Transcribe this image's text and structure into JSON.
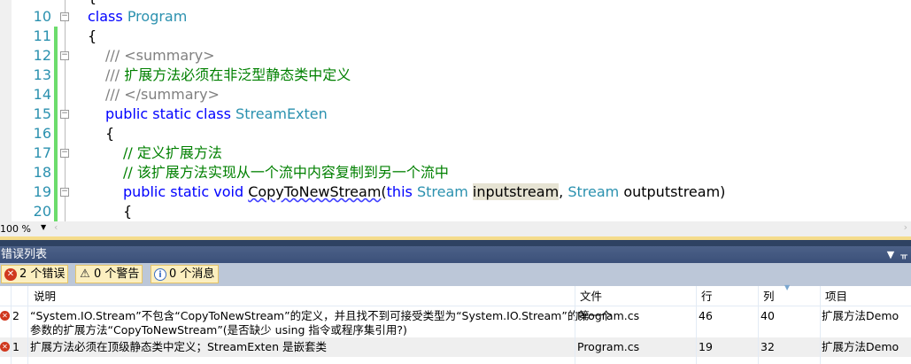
{
  "editor": {
    "lines": [
      {
        "n": "10",
        "fold": true,
        "indent": 0,
        "tokens": [
          [
            "kw",
            "class "
          ],
          [
            "ty",
            "Program"
          ]
        ]
      },
      {
        "n": "11",
        "fold": false,
        "indent": 0,
        "tokens": [
          [
            "",
            "{"
          ]
        ]
      },
      {
        "n": "12",
        "fold": true,
        "indent": 1,
        "tokens": [
          [
            "dc",
            "/// <summary>"
          ]
        ]
      },
      {
        "n": "13",
        "fold": false,
        "indent": 1,
        "tokens": [
          [
            "dc",
            "/// "
          ],
          [
            "cm",
            "扩展方法必须在非泛型静态类中定义"
          ]
        ]
      },
      {
        "n": "14",
        "fold": false,
        "indent": 1,
        "tokens": [
          [
            "dc",
            "/// </summary>"
          ]
        ]
      },
      {
        "n": "15",
        "fold": true,
        "indent": 1,
        "tokens": [
          [
            "kw",
            "public static class "
          ],
          [
            "ty",
            "StreamExten"
          ]
        ]
      },
      {
        "n": "16",
        "fold": false,
        "indent": 1,
        "tokens": [
          [
            "",
            "{"
          ]
        ]
      },
      {
        "n": "17",
        "fold": true,
        "indent": 2,
        "tokens": [
          [
            "cm",
            "// 定义扩展方法"
          ]
        ]
      },
      {
        "n": "18",
        "fold": false,
        "indent": 2,
        "tokens": [
          [
            "cm",
            "// 该扩展方法实现从一个流中内容复制到另一个流中"
          ]
        ]
      },
      {
        "n": "19",
        "fold": true,
        "indent": 2,
        "tokens": [
          [
            "kw",
            "public static void "
          ],
          [
            "sq",
            "CopyToNewStream"
          ],
          [
            "",
            "("
          ],
          [
            "kw",
            "this "
          ],
          [
            "ty",
            "Stream "
          ],
          [
            "hl",
            "inputstream"
          ],
          [
            "",
            ", "
          ],
          [
            "ty",
            "Stream "
          ],
          [
            "",
            "outputstream)"
          ]
        ]
      },
      {
        "n": "20",
        "fold": false,
        "indent": 2,
        "tokens": [
          [
            "",
            "{"
          ]
        ]
      }
    ]
  },
  "zoom": {
    "value": "100 %"
  },
  "panel": {
    "title": "错误列表",
    "filters": [
      {
        "label": "2 个错误",
        "icon": "error-icon",
        "color": "#d0381e"
      },
      {
        "label": "0 个警告",
        "icon": "warning-icon",
        "color": "#f2c200"
      },
      {
        "label": "0 个消息",
        "icon": "info-icon",
        "color": "#3a6fc4"
      }
    ],
    "columns": {
      "desc": "说明",
      "file": "文件",
      "line": "行",
      "col": "列",
      "project": "项目"
    },
    "rows": [
      {
        "num": "2",
        "desc": "“System.IO.Stream”不包含“CopyToNewStream”的定义，并且找不到可接受类型为“System.IO.Stream”的第一个\n参数的扩展方法“CopyToNewStream”(是否缺少 using 指令或程序集引用?)",
        "file": "Program.cs",
        "line": "46",
        "col": "40",
        "project": "扩展方法Demo"
      },
      {
        "num": "1",
        "desc": "扩展方法必须在顶级静态类中定义；StreamExten 是嵌套类",
        "file": "Program.cs",
        "line": "19",
        "col": "32",
        "project": "扩展方法Demo"
      }
    ]
  }
}
